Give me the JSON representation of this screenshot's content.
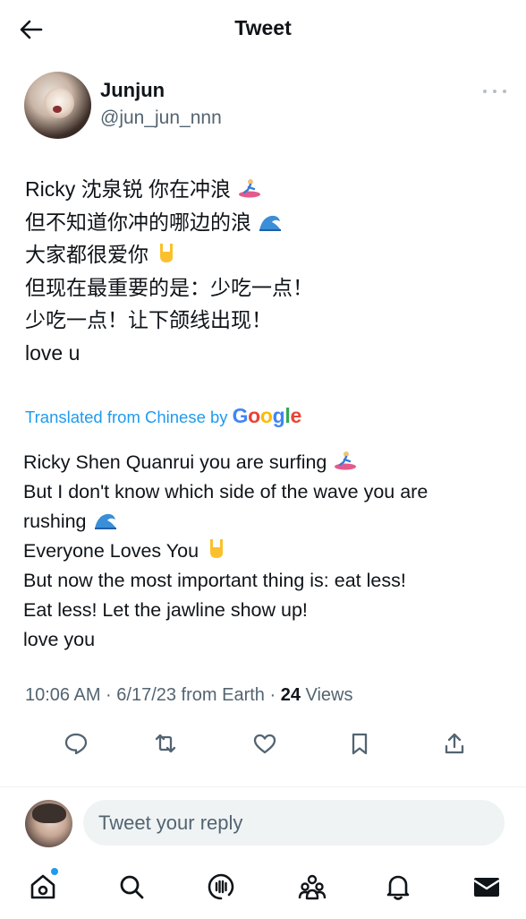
{
  "header": {
    "title": "Tweet",
    "back_icon": "back-arrow-icon"
  },
  "author": {
    "display_name": "Junjun",
    "handle": "@jun_jun_nnn"
  },
  "tweet": {
    "original_lines": [
      "Ricky 沈泉锐 你在冲浪",
      "但不知道你冲的哪边的浪",
      "大家都很爱你",
      "但现在最重要的是：少吃一点！",
      "少吃一点！让下颌线出现！",
      "love u"
    ],
    "translated_label": "Translated from Chinese by",
    "translator_brand": [
      "G",
      "o",
      "o",
      "g",
      "l",
      "e"
    ],
    "translated_lines": [
      "Ricky Shen Quanrui you are surfing",
      "But I don't know which side of the wave you are",
      "rushing",
      "Everyone Loves You",
      "But now the most important thing is: eat less!",
      "Eat less! Let the jawline show up!",
      "love you"
    ],
    "meta_prefix": "10:06 AM · 6/17/23 from Earth · ",
    "views_count": "24",
    "views_label": " Views"
  },
  "actions": [
    "reply-icon",
    "retweet-icon",
    "like-icon",
    "bookmark-icon",
    "share-icon"
  ],
  "reply": {
    "placeholder": "Tweet your reply"
  },
  "nav": [
    "home-icon",
    "search-icon",
    "spaces-icon",
    "communities-icon",
    "notifications-icon",
    "messages-icon"
  ],
  "colors": {
    "accent": "#1d9bf0",
    "text": "#0f1419",
    "secondary": "#536471",
    "input_bg": "#eff3f4"
  }
}
